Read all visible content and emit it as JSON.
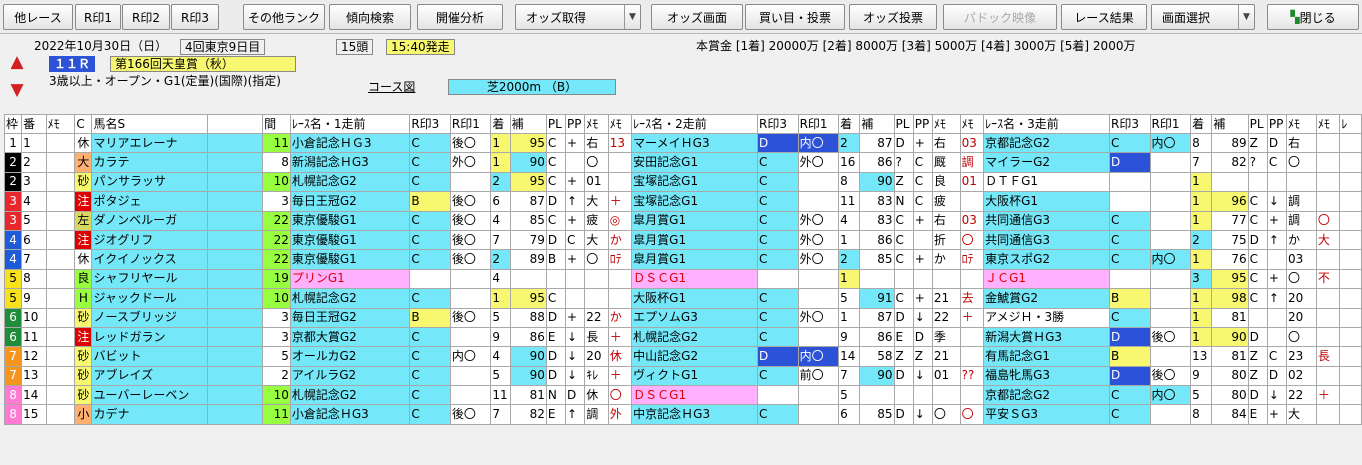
{
  "toolbar": {
    "buttons": [
      {
        "label": "他レース",
        "key": "other-race-button",
        "disabled": false
      },
      {
        "label": "R印1",
        "key": "mark1-button",
        "disabled": false
      },
      {
        "label": "R印2",
        "key": "mark2-button",
        "disabled": false
      },
      {
        "label": "R印3",
        "key": "mark3-button",
        "disabled": false
      },
      {
        "label": "その他ランク",
        "key": "other-rank-button",
        "disabled": false
      },
      {
        "label": "傾向検索",
        "key": "trend-search-button",
        "disabled": false
      },
      {
        "label": "開催分析",
        "key": "meeting-analysis-button",
        "disabled": false
      },
      {
        "label": "オッズ取得",
        "key": "odds-fetch-button",
        "disabled": false,
        "dropdown": true
      },
      {
        "label": "オッズ画面",
        "key": "odds-screen-button",
        "disabled": false
      },
      {
        "label": "買い目・投票",
        "key": "bet-button",
        "disabled": false
      },
      {
        "label": "オッズ投票",
        "key": "odds-vote-button",
        "disabled": false
      },
      {
        "label": "パドック映像",
        "key": "paddock-video-button",
        "disabled": true
      },
      {
        "label": "レース結果",
        "key": "race-result-button",
        "disabled": false
      },
      {
        "label": "画面選択",
        "key": "screen-select-button",
        "disabled": false,
        "dropdown": true
      },
      {
        "label": "閉じる",
        "key": "close-button",
        "disabled": false,
        "icon": true
      }
    ]
  },
  "race": {
    "date": "2022年10月30日（日）",
    "meeting": "4回東京9日目",
    "runners": "15頭",
    "start": "15:40発走",
    "number": "１１Ｒ",
    "name": "第166回天皇賞（秋）",
    "conditions": "3歳以上・オープン・G1(定量)(国際)(指定)",
    "course_label": "コース図",
    "course": "芝2000m （B）",
    "prize": "本賞金 [1着] 20000万 [2着] 8000万 [3着] 5000万 [4着] 3000万 [5着] 2000万"
  },
  "columns": [
    "枠",
    "番",
    "ﾒﾓ",
    "C",
    "馬名S",
    "",
    "間",
    "ﾚｰｽ名・1走前",
    "R印3",
    "R印1",
    "着",
    "補",
    "PL",
    "PP",
    "ﾒﾓ",
    "ﾒﾓ",
    "ﾚｰｽ名・2走前",
    "R印3",
    "R印1",
    "着",
    "補",
    "PL",
    "PP",
    "ﾒﾓ",
    "ﾒﾓ",
    "ﾚｰｽ名・3走前",
    "R印3",
    "R印1",
    "着",
    "補",
    "PL",
    "PP",
    "ﾒﾓ",
    "ﾒﾓ",
    "ﾚ"
  ],
  "colors": {
    "waku": [
      "#ffffff",
      "#000000",
      "#e8262b",
      "#1e5bd8",
      "#f5e21a",
      "#1e8c3a",
      "#f5951e",
      "#ff7ad0"
    ],
    "cyan": "#74e8f8",
    "blue": "#2c52d8",
    "yellow": "#f8f870",
    "lime": "#98ff40",
    "pink": "#ffb0ff",
    "salmon": "#ffb070",
    "navy": "#0000a0",
    "red": "#e00000"
  },
  "rows": [
    {
      "w": 1,
      "n": "1",
      "c": "休",
      "cs": "plain",
      "name": "マリアエレーナ",
      "kan": "11",
      "kc": "lime",
      "r1": {
        "t": "小倉記念ＨＧ3",
        "bg": "cyan"
      },
      "a3": "C",
      "a1": "後〇",
      "p": "1",
      "pb": "yellow",
      "h": "95",
      "hb": "yellow",
      "pl": "C",
      "pp": "+",
      "m1": "右",
      "m2": "13",
      "r2": {
        "t": "マーメイＨG3",
        "bg": "cyan"
      },
      "b3": "D",
      "b1": "内〇",
      "q": "2",
      "qb": "cyan",
      "h2": "87",
      "pl2": "D",
      "pp2": "+",
      "n1": "右",
      "n2": "03",
      "r3": {
        "t": "京都記念G2",
        "bg": "cyan"
      },
      "c3": "C",
      "c1": "内〇",
      "s": "8",
      "h3": "89",
      "pl3": "Z",
      "pp3": "D",
      "o1": "右",
      "o2": ""
    },
    {
      "w": 2,
      "n": "2",
      "c": "大",
      "cs": "salmon",
      "name": "カラテ",
      "kan": "8",
      "kc": "",
      "r1": {
        "t": "新潟記念ＨG3",
        "bg": "cyan"
      },
      "a3": "C",
      "a1": "外〇",
      "p": "1",
      "pb": "yellow",
      "h": "90",
      "hb": "cyan",
      "pl": "C",
      "pp": "",
      "m1": "〇",
      "m2": "",
      "r2": {
        "t": "安田記念G1",
        "bg": "cyan"
      },
      "b3": "C",
      "b1": "外〇",
      "q": "16",
      "qb": "",
      "h2": "86",
      "pl2": "?",
      "pp2": "C",
      "n1": "厩",
      "n2": "調",
      "r3": {
        "t": "マイラーG2",
        "bg": "cyan"
      },
      "c3": "D",
      "c1": "",
      "s": "7",
      "h3": "82",
      "pl3": "?",
      "pp3": "C",
      "o1": "〇",
      "o2": ""
    },
    {
      "w": 2,
      "n": "3",
      "c": "砂",
      "cs": "yellow",
      "name": "パンサラッサ",
      "kan": "10",
      "kc": "lime",
      "r1": {
        "t": "札幌記念G2",
        "bg": "cyan"
      },
      "a3": "C",
      "a1": "",
      "p": "2",
      "pb": "cyan",
      "h": "95",
      "hb": "yellow",
      "pl": "C",
      "pp": "+",
      "m1": "01",
      "m2": "",
      "r2": {
        "t": "宝塚記念G1",
        "bg": "cyan"
      },
      "b3": "C",
      "b1": "",
      "q": "8",
      "qb": "",
      "h2": "90",
      "pl2": "Z",
      "pp2": "C",
      "n1": "良",
      "n2": "01",
      "r3": {
        "t": "ＤＴＦG1",
        "bg": ""
      },
      "c3": "",
      "c1": "",
      "s": "1",
      "h3": "",
      "pl3": "",
      "pp3": "",
      "o1": "",
      "o2": ""
    },
    {
      "w": 3,
      "n": "4",
      "c": "注",
      "cs": "red",
      "name": "ポタジェ",
      "kan": "3",
      "kc": "",
      "r1": {
        "t": "毎日王冠G2",
        "bg": "cyan"
      },
      "a3": "B",
      "a1": "後〇",
      "p": "6",
      "pb": "",
      "h": "87",
      "hb": "",
      "pl": "D",
      "pp": "↑",
      "m1": "大",
      "m2": "＋",
      "r2": {
        "t": "宝塚記念G1",
        "bg": "cyan"
      },
      "b3": "C",
      "b1": "",
      "q": "11",
      "qb": "",
      "h2": "83",
      "pl2": "N",
      "pp2": "C",
      "n1": "疲",
      "n2": "",
      "r3": {
        "t": "大阪杯G1",
        "bg": "cyan"
      },
      "c3": "",
      "c1": "",
      "s": "1",
      "h3": "96",
      "pl3": "C",
      "pp3": "↓",
      "o1": "調",
      "o2": ""
    },
    {
      "w": 3,
      "n": "5",
      "c": "左",
      "cs": "olive",
      "name": "ダノンベルーガ",
      "kan": "22",
      "kc": "lime",
      "r1": {
        "t": "東京優駿G1",
        "bg": "cyan"
      },
      "a3": "C",
      "a1": "後〇",
      "p": "4",
      "pb": "",
      "h": "85",
      "hb": "",
      "pl": "C",
      "pp": "+",
      "m1": "疲",
      "m2": "◎",
      "r2": {
        "t": "皐月賞G1",
        "bg": "cyan"
      },
      "b3": "C",
      "b1": "外〇",
      "q": "4",
      "qb": "",
      "h2": "83",
      "pl2": "C",
      "pp2": "+",
      "n1": "右",
      "n2": "03",
      "r3": {
        "t": "共同通信G3",
        "bg": "cyan"
      },
      "c3": "C",
      "c1": "",
      "s": "1",
      "h3": "77",
      "pl3": "C",
      "pp3": "+",
      "o1": "調",
      "o2": "〇"
    },
    {
      "w": 4,
      "n": "6",
      "c": "注",
      "cs": "red",
      "name": "ジオグリフ",
      "kan": "22",
      "kc": "lime",
      "r1": {
        "t": "東京優駿G1",
        "bg": "cyan"
      },
      "a3": "C",
      "a1": "後〇",
      "p": "7",
      "pb": "",
      "h": "79",
      "hb": "",
      "pl": "D",
      "pp": "C",
      "m1": "大",
      "m2": "か",
      "r2": {
        "t": "皐月賞G1",
        "bg": "cyan"
      },
      "b3": "C",
      "b1": "外〇",
      "q": "1",
      "qb": "",
      "h2": "86",
      "pl2": "C",
      "pp2": "",
      "n1": "折",
      "n2": "〇",
      "r3": {
        "t": "共同通信G3",
        "bg": "cyan"
      },
      "c3": "C",
      "c1": "",
      "s": "2",
      "h3": "75",
      "pl3": "D",
      "pp3": "↑",
      "o1": "か",
      "o2": "大"
    },
    {
      "w": 4,
      "n": "7",
      "c": "休",
      "cs": "plain",
      "name": "イクイノックス",
      "kan": "22",
      "kc": "lime",
      "r1": {
        "t": "東京優駿G1",
        "bg": "cyan"
      },
      "a3": "C",
      "a1": "後〇",
      "p": "2",
      "pb": "cyan",
      "h": "89",
      "hb": "",
      "pl": "B",
      "pp": "+",
      "m1": "〇",
      "m2": "ﾛﾃ",
      "r2": {
        "t": "皐月賞G1",
        "bg": "cyan"
      },
      "b3": "C",
      "b1": "外〇",
      "q": "2",
      "qb": "cyan",
      "h2": "85",
      "pl2": "C",
      "pp2": "+",
      "n1": "か",
      "n2": "ﾛﾃ",
      "r3": {
        "t": "東京スポG2",
        "bg": "cyan"
      },
      "c3": "C",
      "c1": "内〇",
      "s": "1",
      "h3": "76",
      "pl3": "C",
      "pp3": "",
      "o1": "03",
      "o2": ""
    },
    {
      "w": 5,
      "n": "8",
      "c": "良",
      "cs": "lime",
      "name": "シャフリヤール",
      "kan": "19",
      "kc": "lime",
      "r1": {
        "t": "プリンG1",
        "bg": "pink"
      },
      "a3": "",
      "a1": "",
      "p": "4",
      "pb": "",
      "h": "",
      "hb": "",
      "pl": "",
      "pp": "",
      "m1": "",
      "m2": "",
      "r2": {
        "t": "ＤＳＣG1",
        "bg": "pink"
      },
      "b3": "",
      "b1": "",
      "q": "1",
      "qb": "yellow",
      "h2": "",
      "pl2": "",
      "pp2": "",
      "n1": "",
      "n2": "",
      "r3": {
        "t": "ＪＣG1",
        "bg": "pink"
      },
      "c3": "",
      "c1": "",
      "s": "3",
      "h3": "95",
      "pl3": "C",
      "pp3": "+",
      "o1": "〇",
      "o2": "不"
    },
    {
      "w": 5,
      "n": "9",
      "c": "H",
      "cs": "lime",
      "name": "ジャックドール",
      "kan": "10",
      "kc": "lime",
      "r1": {
        "t": "札幌記念G2",
        "bg": "cyan"
      },
      "a3": "C",
      "a1": "",
      "p": "1",
      "pb": "yellow",
      "h": "95",
      "hb": "yellow",
      "pl": "C",
      "pp": "",
      "m1": "",
      "m2": "",
      "r2": {
        "t": "大阪杯G1",
        "bg": "cyan"
      },
      "b3": "C",
      "b1": "",
      "q": "5",
      "qb": "",
      "h2": "91",
      "pl2": "C",
      "pp2": "+",
      "n1": "21",
      "n2": "去",
      "r3": {
        "t": "金鯱賞G2",
        "bg": "cyan"
      },
      "c3": "B",
      "c1": "",
      "s": "1",
      "h3": "98",
      "pl3": "C",
      "pp3": "↑",
      "o1": "20",
      "o2": ""
    },
    {
      "w": 6,
      "n": "10",
      "c": "砂",
      "cs": "yellow",
      "name": "ノースブリッジ",
      "kan": "3",
      "kc": "",
      "r1": {
        "t": "毎日王冠G2",
        "bg": "cyan"
      },
      "a3": "B",
      "a1": "後〇",
      "p": "5",
      "pb": "",
      "h": "88",
      "hb": "",
      "pl": "D",
      "pp": "+",
      "m1": "22",
      "m2": "か",
      "r2": {
        "t": "エプソムG3",
        "bg": "cyan"
      },
      "b3": "C",
      "b1": "外〇",
      "q": "1",
      "qb": "",
      "h2": "87",
      "pl2": "D",
      "pp2": "↓",
      "n1": "22",
      "n2": "＋",
      "r3": {
        "t": "アメジＨ・3勝",
        "bg": ""
      },
      "c3": "C",
      "c1": "",
      "s": "1",
      "h3": "81",
      "pl3": "",
      "pp3": "",
      "o1": "20",
      "o2": ""
    },
    {
      "w": 6,
      "n": "11",
      "c": "注",
      "cs": "red",
      "name": "レッドガラン",
      "kan": "3",
      "kc": "",
      "r1": {
        "t": "京都大賞G2",
        "bg": "cyan"
      },
      "a3": "C",
      "a1": "",
      "p": "9",
      "pb": "",
      "h": "86",
      "hb": "",
      "pl": "E",
      "pp": "↓",
      "m1": "長",
      "m2": "＋",
      "r2": {
        "t": "札幌記念G2",
        "bg": "cyan"
      },
      "b3": "C",
      "b1": "",
      "q": "9",
      "qb": "",
      "h2": "86",
      "pl2": "E",
      "pp2": "D",
      "n1": "季",
      "n2": "",
      "r3": {
        "t": "新潟大賞ＨG3",
        "bg": "cyan"
      },
      "c3": "D",
      "c1": "後〇",
      "s": "1",
      "h3": "90",
      "pl3": "D",
      "pp3": "",
      "o1": "〇",
      "o2": ""
    },
    {
      "w": 7,
      "n": "12",
      "c": "砂",
      "cs": "yellow",
      "name": "バビット",
      "kan": "5",
      "kc": "",
      "r1": {
        "t": "オールカG2",
        "bg": "cyan"
      },
      "a3": "C",
      "a1": "内〇",
      "p": "4",
      "pb": "",
      "h": "90",
      "hb": "cyan",
      "pl": "D",
      "pp": "↓",
      "m1": "20",
      "m2": "休",
      "r2": {
        "t": "中山記念G2",
        "bg": "cyan"
      },
      "b3": "D",
      "b1": "内〇",
      "q": "14",
      "qb": "",
      "h2": "58",
      "pl2": "Z",
      "pp2": "Z",
      "n1": "21",
      "n2": "",
      "r3": {
        "t": "有馬記念G1",
        "bg": "cyan"
      },
      "c3": "B",
      "c1": "",
      "s": "13",
      "h3": "81",
      "pl3": "Z",
      "pp3": "C",
      "o1": "23",
      "o2": "長"
    },
    {
      "w": 7,
      "n": "13",
      "c": "砂",
      "cs": "yellow",
      "name": "アブレイズ",
      "kan": "2",
      "kc": "",
      "r1": {
        "t": "アイルラG2",
        "bg": "cyan"
      },
      "a3": "C",
      "a1": "",
      "p": "5",
      "pb": "",
      "h": "90",
      "hb": "cyan",
      "pl": "D",
      "pp": "↓",
      "m1": "ｷﾚ",
      "m2": "＋",
      "r2": {
        "t": "ヴィクトG1",
        "bg": "cyan"
      },
      "b3": "C",
      "b1": "前〇",
      "q": "7",
      "qb": "",
      "h2": "90",
      "pl2": "D",
      "pp2": "↓",
      "n1": "01",
      "n2": "??",
      "r3": {
        "t": "福島牝馬G3",
        "bg": "cyan"
      },
      "c3": "D",
      "c1": "後〇",
      "s": "9",
      "h3": "80",
      "pl3": "Z",
      "pp3": "D",
      "o1": "02",
      "o2": ""
    },
    {
      "w": 8,
      "n": "14",
      "c": "砂",
      "cs": "yellow",
      "name": "ユーバーレーベン",
      "kan": "10",
      "kc": "lime",
      "r1": {
        "t": "札幌記念G2",
        "bg": "cyan"
      },
      "a3": "C",
      "a1": "",
      "p": "11",
      "pb": "",
      "h": "81",
      "hb": "",
      "pl": "N",
      "pp": "D",
      "m1": "休",
      "m2": "〇",
      "r2": {
        "t": "ＤＳＣG1",
        "bg": "pink"
      },
      "b3": "",
      "b1": "",
      "q": "5",
      "qb": "",
      "h2": "",
      "pl2": "",
      "pp2": "",
      "n1": "",
      "n2": "",
      "r3": {
        "t": "京都記念G2",
        "bg": "cyan"
      },
      "c3": "C",
      "c1": "内〇",
      "s": "5",
      "h3": "80",
      "pl3": "D",
      "pp3": "↓",
      "o1": "22",
      "o2": "＋"
    },
    {
      "w": 8,
      "n": "15",
      "c": "小",
      "cs": "salmon",
      "name": "カデナ",
      "kan": "11",
      "kc": "lime",
      "r1": {
        "t": "小倉記念ＨG3",
        "bg": "cyan"
      },
      "a3": "C",
      "a1": "後〇",
      "p": "7",
      "pb": "",
      "h": "82",
      "hb": "",
      "pl": "E",
      "pp": "↑",
      "m1": "調",
      "m2": "外",
      "r2": {
        "t": "中京記念ＨG3",
        "bg": "cyan"
      },
      "b3": "C",
      "b1": "",
      "q": "6",
      "qb": "",
      "h2": "85",
      "pl2": "D",
      "pp2": "↓",
      "n1": "〇",
      "n2": "〇",
      "r3": {
        "t": "平安ＳG3",
        "bg": "cyan"
      },
      "c3": "C",
      "c1": "",
      "s": "8",
      "h3": "84",
      "pl3": "E",
      "pp3": "+",
      "o1": "大",
      "o2": ""
    }
  ]
}
